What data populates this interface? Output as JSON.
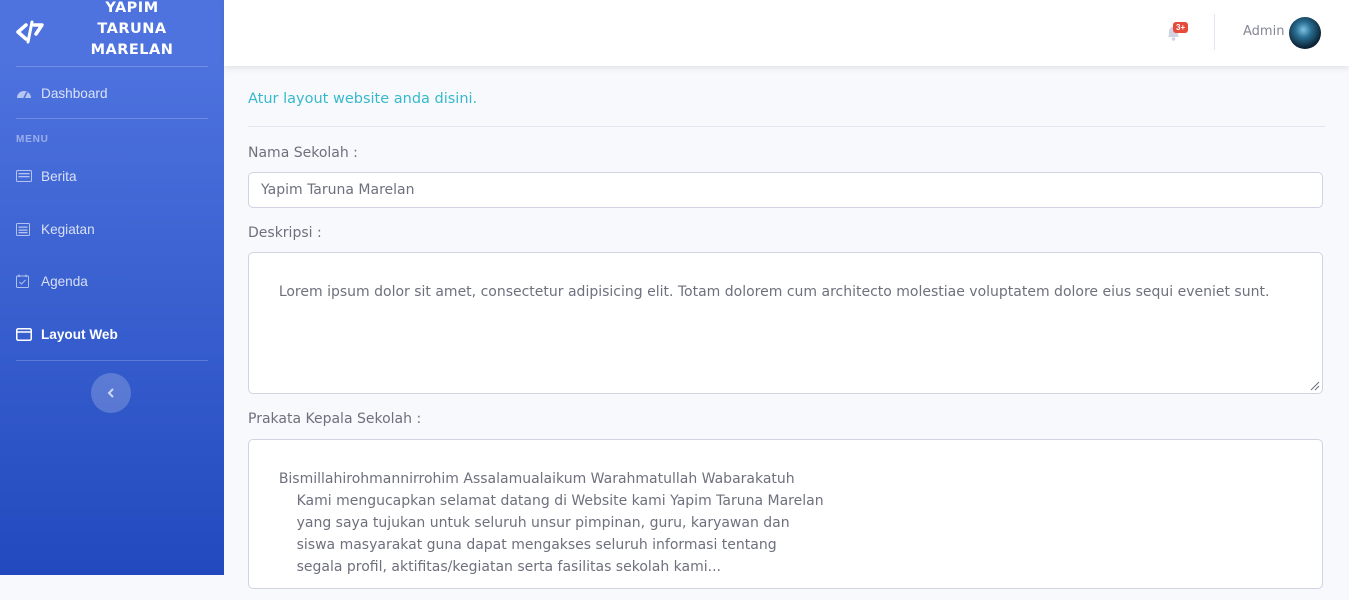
{
  "brand": {
    "name": "YAPIM TARUNA MARELAN"
  },
  "sidebar": {
    "dashboard_label": "Dashboard",
    "heading": "MENU",
    "items": [
      {
        "label": "Berita",
        "icon": "newspaper-icon"
      },
      {
        "label": "Kegiatan",
        "icon": "list-icon"
      },
      {
        "label": "Agenda",
        "icon": "calendar-check-icon"
      },
      {
        "label": "Layout Web",
        "icon": "window-icon",
        "active": true
      }
    ]
  },
  "topbar": {
    "notification_badge": "3+",
    "user_name": "Admin"
  },
  "content": {
    "intro": "Atur layout website anda disini.",
    "school_name_label": "Nama Sekolah :",
    "school_name_value": "Yapim Taruna Marelan",
    "description_label": "Deskripsi :",
    "description_value": "Lorem ipsum dolor sit amet, consectetur adipisicing elit. Totam dolorem cum architecto molestiae voluptatem dolore eius sequi eveniet sunt.",
    "foreword_label": "Prakata Kepala Sekolah :",
    "foreword_value": "Bismillahirohmannirrohim Assalamualaikum Warahmatullah Wabarakatuh\n        Kami mengucapkan selamat datang di Website kami Yapim Taruna Marelan\n        yang saya tujukan untuk seluruh unsur pimpinan, guru, karyawan dan\n        siswa masyarakat guna dapat mengakses seluruh informasi tentang\n        segala profil, aktifitas/kegiatan serta fasilitas sekolah kami..."
  },
  "colors": {
    "sidebar_primary": "#4e73df",
    "sidebar_dark": "#224abe",
    "accent_info": "#36b9cc",
    "badge_danger": "#e74a3b"
  }
}
